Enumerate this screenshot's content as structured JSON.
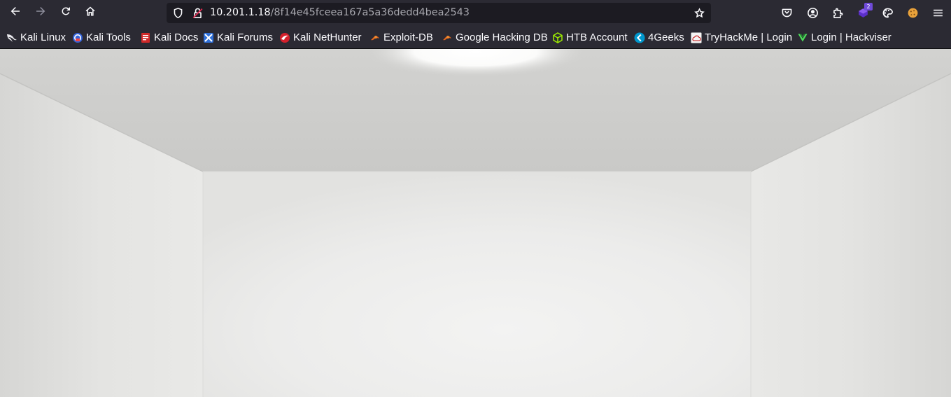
{
  "browser": {
    "nav": {
      "back_icon": "arrow-left-icon",
      "forward_icon": "arrow-right-icon",
      "reload_icon": "reload-icon",
      "home_icon": "home-icon"
    },
    "urlbar": {
      "host": "10.201.1.18",
      "path": "/8f14e45fceea167a5a36dedd4bea2543",
      "shield_icon": "tracking-protection-shield-icon",
      "lock_icon": "insecure-lock-icon",
      "star_icon": "bookmark-star-icon"
    },
    "toolbar_icons": {
      "pocket_icon": "pocket-icon",
      "account_icon": "account-icon",
      "extensions_icon": "extensions-icon",
      "extension_badge": "2",
      "cookie_icon": "cookie-icon",
      "menu_icon": "hamburger-menu-icon"
    },
    "colors": {
      "toolbar_bg": "#2b2a33",
      "urlbar_bg": "#1c1b22",
      "text": "#fbfbfe",
      "url_path": "#a6a6ad"
    }
  },
  "bookmarks": [
    {
      "label": "Kali Linux",
      "icon": "kali-dragon-icon"
    },
    {
      "label": "Kali Tools",
      "icon": "kali-tools-icon"
    },
    {
      "label": "Kali Docs",
      "icon": "kali-docs-icon"
    },
    {
      "label": "Kali Forums",
      "icon": "kali-forums-icon"
    },
    {
      "label": "Kali NetHunter",
      "icon": "kali-nethunter-icon"
    },
    {
      "label": "Exploit-DB",
      "icon": "exploit-db-icon"
    },
    {
      "label": "Google Hacking DB",
      "icon": "google-hacking-db-icon"
    },
    {
      "label": "HTB Account",
      "icon": "htb-cube-icon"
    },
    {
      "label": "4Geeks",
      "icon": "4geeks-icon"
    },
    {
      "label": "TryHackMe | Login",
      "icon": "tryhackme-icon"
    },
    {
      "label": "Login | Hackviser",
      "icon": "hackviser-icon"
    }
  ],
  "page": {
    "content": "empty-white-room-image"
  }
}
